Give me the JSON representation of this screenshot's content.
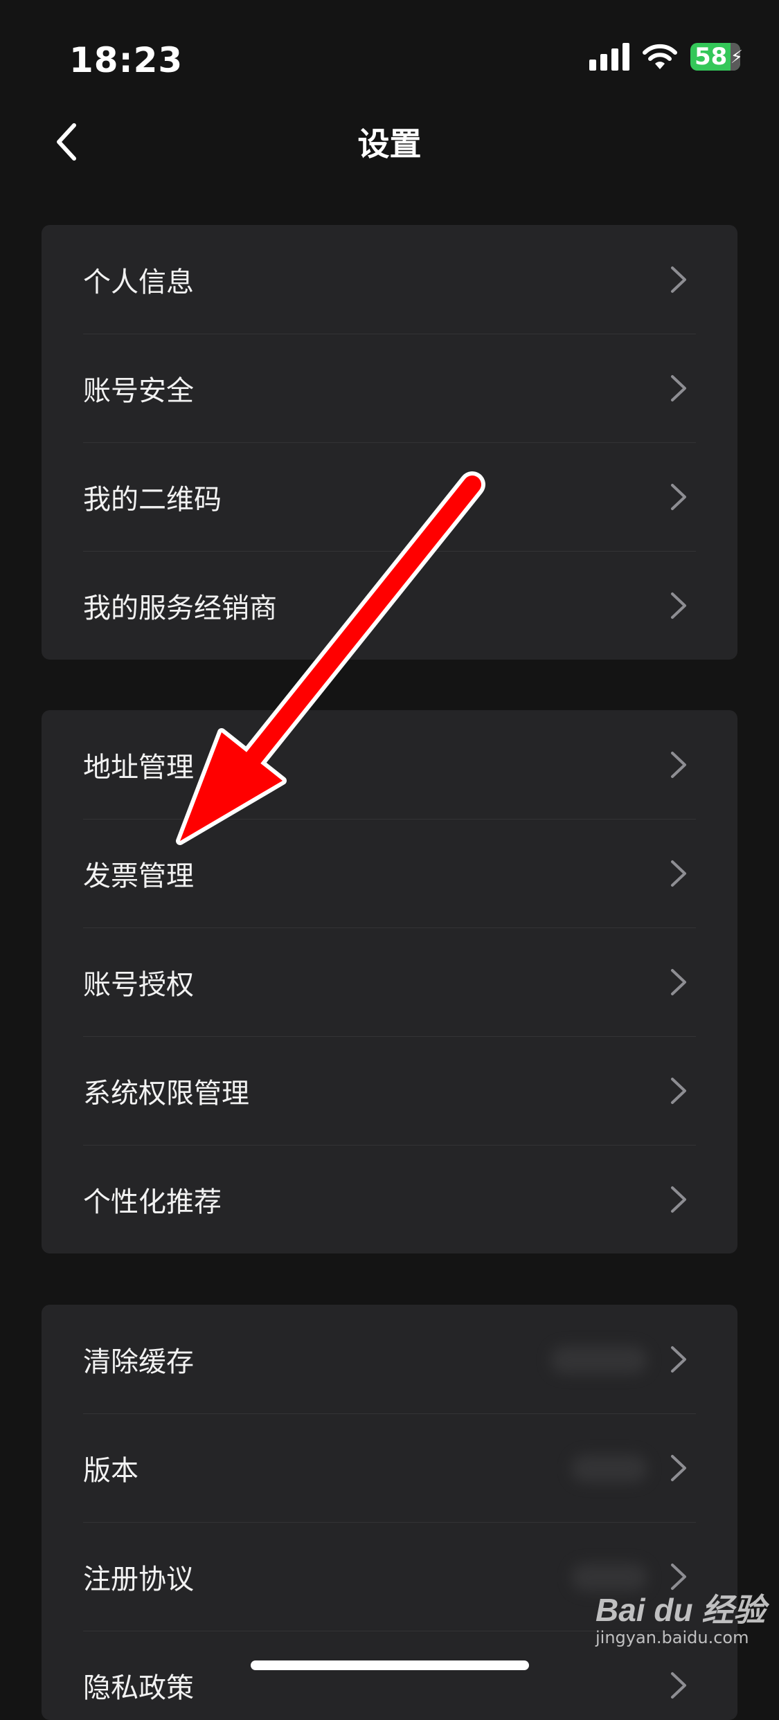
{
  "status_bar": {
    "time": "18:23",
    "battery_level": "58",
    "signal_icon": "cellular-signal-icon",
    "wifi_icon": "wifi-icon",
    "battery_icon": "battery-charging-icon"
  },
  "nav": {
    "title": "设置",
    "back_icon": "chevron-left-icon"
  },
  "groups": [
    {
      "items": [
        {
          "label": "个人信息"
        },
        {
          "label": "账号安全"
        },
        {
          "label": "我的二维码"
        },
        {
          "label": "我的服务经销商"
        }
      ]
    },
    {
      "items": [
        {
          "label": "地址管理"
        },
        {
          "label": "发票管理"
        },
        {
          "label": "账号授权"
        },
        {
          "label": "系统权限管理"
        },
        {
          "label": "个性化推荐"
        }
      ]
    },
    {
      "items": [
        {
          "label": "清除缓存"
        },
        {
          "label": "版本"
        },
        {
          "label": "注册协议"
        },
        {
          "label": "隐私政策"
        }
      ]
    }
  ],
  "annotation": {
    "arrow_color": "#ff0000",
    "arrow_target": "发票管理"
  },
  "watermark": {
    "brand": "Bai du 经验",
    "url": "jingyan.baidu.com"
  },
  "colors": {
    "background": "#141414",
    "card": "#252527",
    "battery": "#34c759"
  }
}
